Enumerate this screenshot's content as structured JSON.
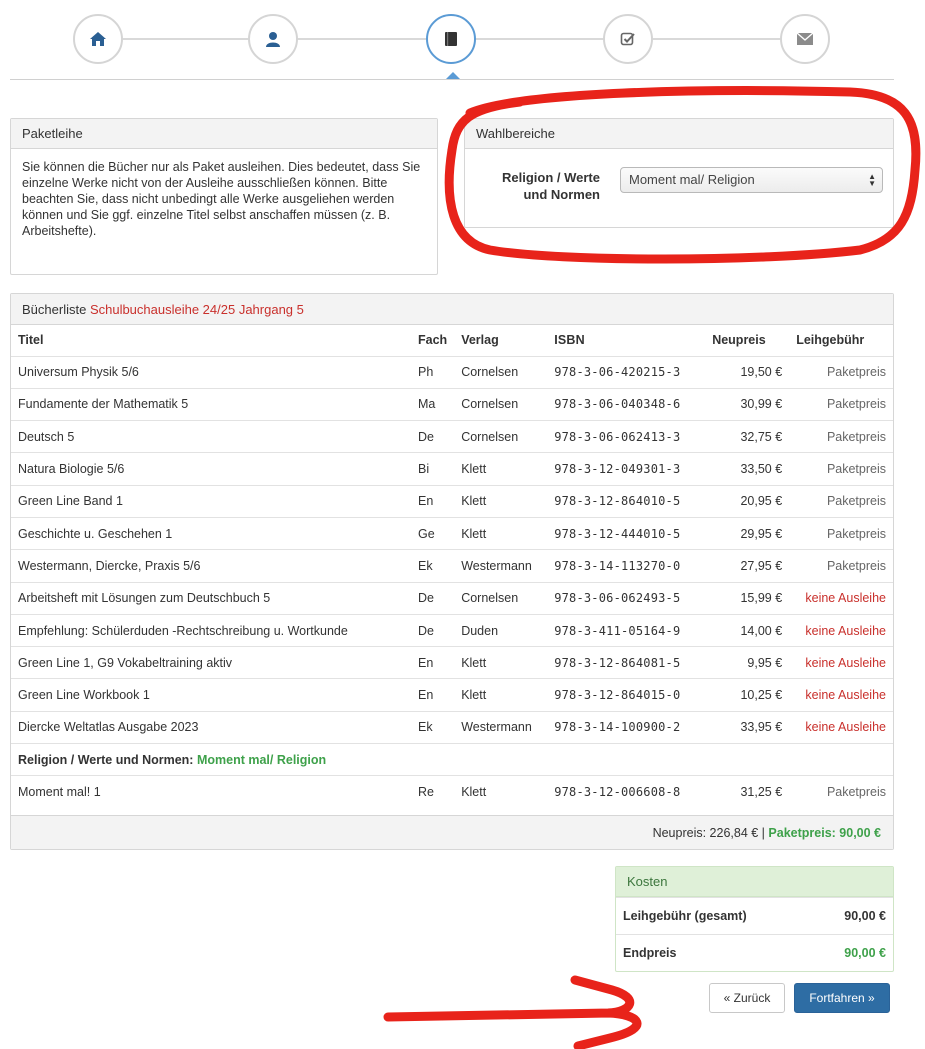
{
  "wizard": {
    "steps": [
      {
        "icon": "home-icon"
      },
      {
        "icon": "user-icon"
      },
      {
        "icon": "book-icon",
        "active": true
      },
      {
        "icon": "check-icon"
      },
      {
        "icon": "envelope-icon"
      }
    ]
  },
  "paketleihe": {
    "title": "Paketleihe",
    "text": "Sie können die Bücher nur als Paket ausleihen. Dies bedeutet, dass Sie einzelne Werke nicht von der Ausleihe ausschließen können. Bitte beachten Sie, dass nicht unbedingt alle Werke ausgeliehen werden können und Sie ggf. einzelne Titel selbst anschaffen müssen (z. B. Arbeitshefte)."
  },
  "wahlbereiche": {
    "title": "Wahlbereiche",
    "label_line1": "Religion / Werte",
    "label_line2": "und Normen",
    "selected": "Moment mal/ Religion"
  },
  "buecherliste": {
    "title": "Bücherliste",
    "subtitle": "Schulbuchausleihe 24/25 Jahrgang 5",
    "columns": [
      "Titel",
      "Fach",
      "Verlag",
      "ISBN",
      "Neupreis",
      "Leihgebühr"
    ],
    "rows": [
      [
        "Universum Physik 5/6",
        "Ph",
        "Cornelsen",
        "978-3-06-420215-3",
        "19,50 €",
        "Paketpreis"
      ],
      [
        "Fundamente der Mathematik 5",
        "Ma",
        "Cornelsen",
        "978-3-06-040348-6",
        "30,99 €",
        "Paketpreis"
      ],
      [
        "Deutsch 5",
        "De",
        "Cornelsen",
        "978-3-06-062413-3",
        "32,75 €",
        "Paketpreis"
      ],
      [
        "Natura Biologie 5/6",
        "Bi",
        "Klett",
        "978-3-12-049301-3",
        "33,50 €",
        "Paketpreis"
      ],
      [
        "Green Line Band 1",
        "En",
        "Klett",
        "978-3-12-864010-5",
        "20,95 €",
        "Paketpreis"
      ],
      [
        "Geschichte u. Geschehen 1",
        "Ge",
        "Klett",
        "978-3-12-444010-5",
        "29,95 €",
        "Paketpreis"
      ],
      [
        "Westermann, Diercke, Praxis 5/6",
        "Ek",
        "Westermann",
        "978-3-14-113270-0",
        "27,95 €",
        "Paketpreis"
      ],
      [
        "Arbeitsheft mit Lösungen zum Deutschbuch 5",
        "De",
        "Cornelsen",
        "978-3-06-062493-5",
        "15,99 €",
        "keine Ausleihe"
      ],
      [
        "Empfehlung: Schülerduden -Rechtschreibung u. Wortkunde",
        "De",
        "Duden",
        "978-3-411-05164-9",
        "14,00 €",
        "keine Ausleihe"
      ],
      [
        "Green Line 1, G9 Vokabeltraining aktiv",
        "En",
        "Klett",
        "978-3-12-864081-5",
        "9,95 €",
        "keine Ausleihe"
      ],
      [
        "Green Line Workbook 1",
        "En",
        "Klett",
        "978-3-12-864015-0",
        "10,25 €",
        "keine Ausleihe"
      ],
      [
        "Diercke Weltatlas Ausgabe 2023",
        "Ek",
        "Westermann",
        "978-3-14-100900-2",
        "33,95 €",
        "keine Ausleihe"
      ]
    ],
    "group_label": "Religion / Werte und Normen:",
    "group_value": "Moment mal/ Religion",
    "group_row": [
      "Moment mal! 1",
      "Re",
      "Klett",
      "978-3-12-006608-8",
      "31,25 €",
      "Paketpreis"
    ],
    "neupreis_total": "Neupreis: 226,84 € |",
    "paketpreis_total": "Paketpreis: 90,00 €"
  },
  "kosten": {
    "title": "Kosten",
    "leihgebuehr_label": "Leihgebühr (gesamt)",
    "leihgebuehr_value": "90,00 €",
    "endpreis_label": "Endpreis",
    "endpreis_value": "90,00 €"
  },
  "buttons": {
    "back": "« Zurück",
    "next": "Fortfahren »"
  },
  "colors": {
    "accent": "#2e6da4",
    "red": "#c9302c",
    "green": "#3ea14a",
    "annotation": "#e8231a"
  }
}
